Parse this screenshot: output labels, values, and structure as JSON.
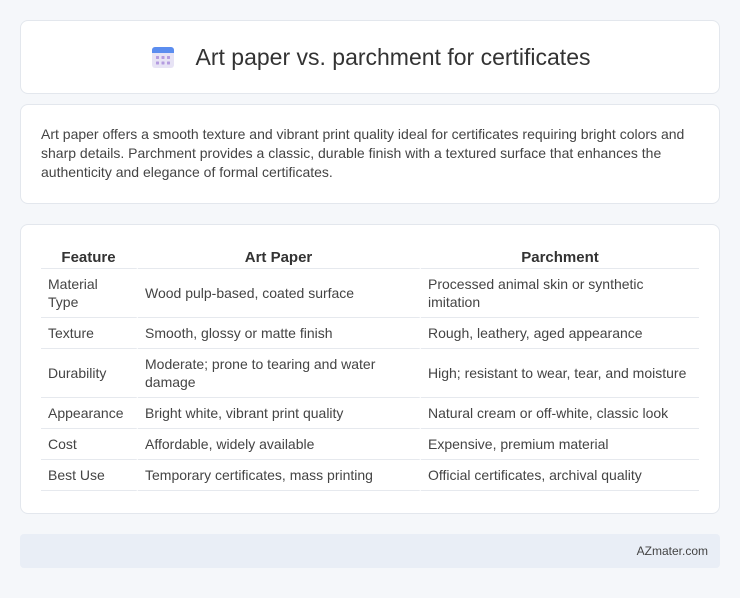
{
  "header": {
    "title": "Art paper vs. parchment for certificates",
    "icon": "calendar-icon"
  },
  "intro": {
    "text": "Art paper offers a smooth texture and vibrant print quality ideal for certificates requiring bright colors and sharp details. Parchment provides a classic, durable finish with a textured surface that enhances the authenticity and elegance of formal certificates."
  },
  "table": {
    "headers": [
      "Feature",
      "Art Paper",
      "Parchment"
    ],
    "rows": [
      [
        "Material Type",
        "Wood pulp-based, coated surface",
        "Processed animal skin or synthetic imitation"
      ],
      [
        "Texture",
        "Smooth, glossy or matte finish",
        "Rough, leathery, aged appearance"
      ],
      [
        "Durability",
        "Moderate; prone to tearing and water damage",
        "High; resistant to wear, tear, and moisture"
      ],
      [
        "Appearance",
        "Bright white, vibrant print quality",
        "Natural cream or off-white, classic look"
      ],
      [
        "Cost",
        "Affordable, widely available",
        "Expensive, premium material"
      ],
      [
        "Best Use",
        "Temporary certificates, mass printing",
        "Official certificates, archival quality"
      ]
    ]
  },
  "footer": {
    "brand": "AZmater.com"
  }
}
